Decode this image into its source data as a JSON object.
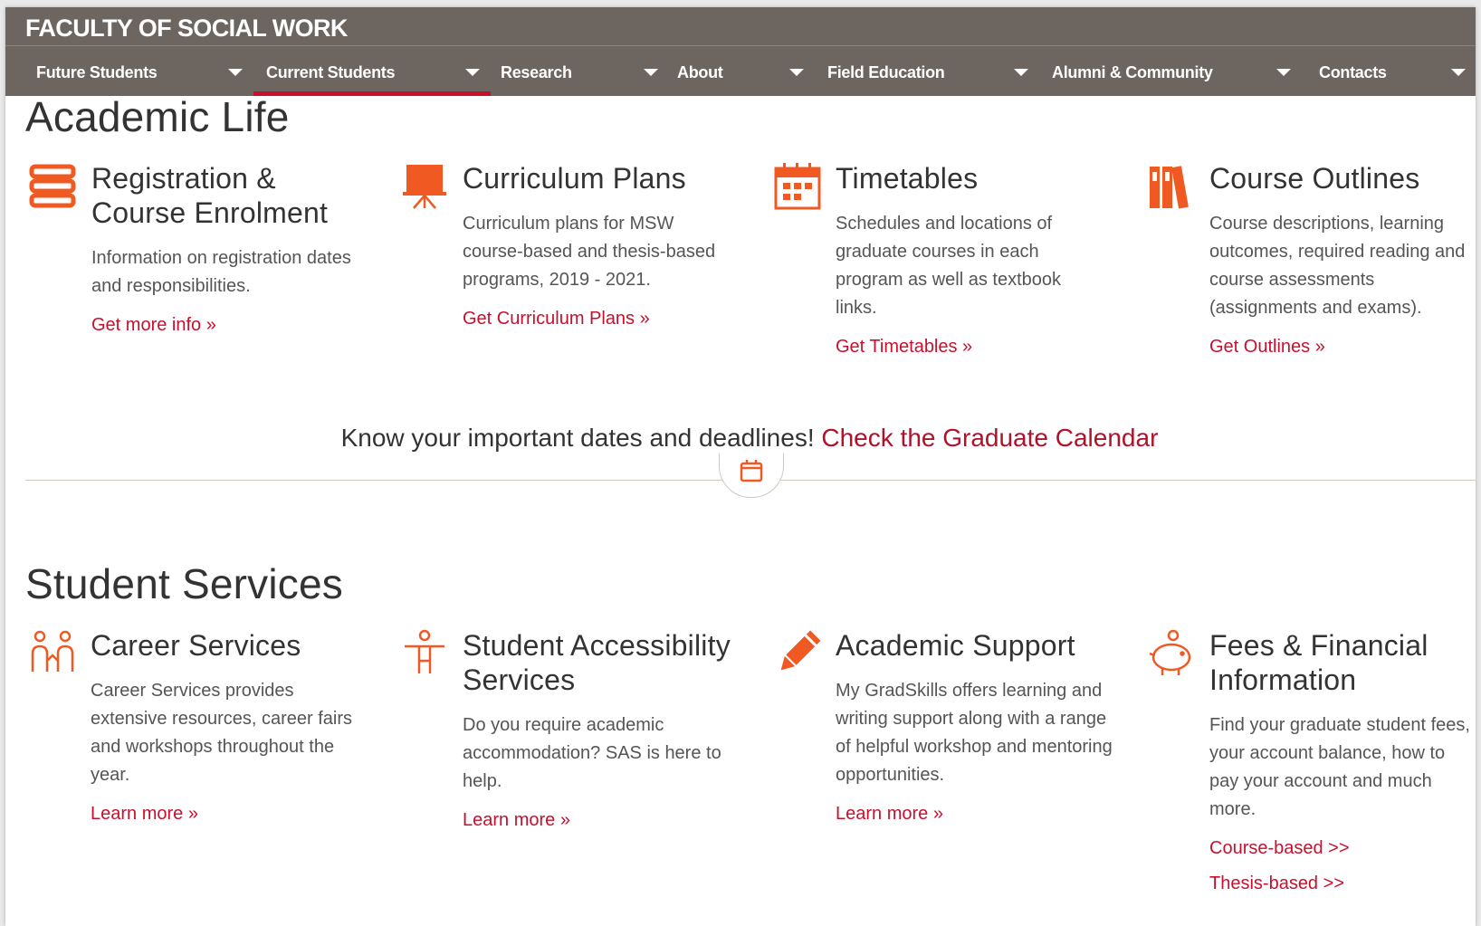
{
  "site": {
    "title": "FACULTY OF SOCIAL WORK"
  },
  "nav": {
    "items": [
      {
        "label": "Future Students"
      },
      {
        "label": "Current Students"
      },
      {
        "label": "Research"
      },
      {
        "label": "About"
      },
      {
        "label": "Field Education"
      },
      {
        "label": "Alumni & Community"
      },
      {
        "label": "Contacts"
      }
    ],
    "active_index": 1
  },
  "academic_life": {
    "heading": "Academic Life",
    "cards": [
      {
        "icon": "books-stack-icon",
        "title": "Registration & Course Enrolment",
        "text": "Information on registration dates and responsibilities.",
        "link": "Get more info »"
      },
      {
        "icon": "presentation-board-icon",
        "title": "Curriculum Plans",
        "text": "Curriculum plans for MSW course-based and thesis-based programs, 2019 - 2021.",
        "link": "Get Curriculum Plans »"
      },
      {
        "icon": "calendar-grid-icon",
        "title": "Timetables",
        "text": "Schedules and locations of graduate courses in each program as well as textbook links.",
        "link": "Get Timetables »"
      },
      {
        "icon": "binders-icon",
        "title": "Course Outlines",
        "text": "Course descriptions, learning outcomes, required reading and course assessments (assignments and exams).",
        "link": "Get Outlines »"
      }
    ]
  },
  "calendar_banner": {
    "text": "Know your important dates and deadlines!",
    "link": "Check the Graduate Calendar",
    "icon": "calendar-icon"
  },
  "student_services": {
    "heading": "Student Services",
    "cards": [
      {
        "icon": "people-icon",
        "title": "Career Services",
        "text": "Career Services provides extensive resources, career fairs and workshops throughout the year.",
        "link": "Learn more »"
      },
      {
        "icon": "accessibility-icon",
        "title": "Student Accessibility Services",
        "text": "Do you require academic accommodation? SAS is here to help.",
        "link": "Learn more »"
      },
      {
        "icon": "pencil-icon",
        "title": "Academic Support",
        "text": "My GradSkills offers learning and writing support along with a range of helpful workshop and mentoring opportunities.",
        "link": "Learn more »"
      },
      {
        "icon": "piggy-bank-icon",
        "title": "Fees & Financial Information",
        "text": "Find your graduate student fees, your account balance, how to pay your account and much more.",
        "link": "Course-based >>",
        "link2": "Thesis-based >>"
      }
    ]
  },
  "colors": {
    "header_bg": "#6d655f",
    "accent_red": "#c8102e",
    "icon_orange": "#f05a22"
  }
}
